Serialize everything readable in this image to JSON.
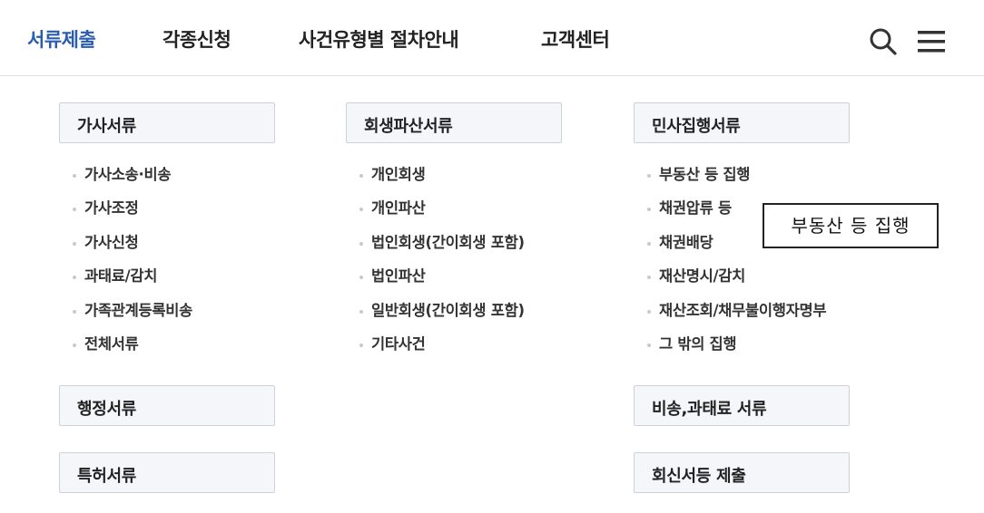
{
  "nav": {
    "items": [
      "서류제출",
      "각종신청",
      "사건유형별 절차안내",
      "고객센터"
    ],
    "active": "서류제출",
    "search_icon": "search-icon",
    "menu_icon": "hamburger-menu-icon",
    "accent_color": "#2a5db0"
  },
  "columns": [
    {
      "categories": [
        {
          "label": "가사서류",
          "items": [
            "가사소송·비송",
            "가사조정",
            "가사신청",
            "과태료/감치",
            "가족관계등록비송",
            "전체서류"
          ]
        },
        {
          "label": "행정서류"
        },
        {
          "label": "특허서류"
        }
      ]
    },
    {
      "categories": [
        {
          "label": "회생파산서류",
          "items": [
            "개인회생",
            "개인파산",
            "법인회생(간이회생 포함)",
            "법인파산",
            "일반회생(간이회생 포함)",
            "기타사건"
          ]
        }
      ]
    },
    {
      "categories": [
        {
          "label": "민사집행서류",
          "items": [
            "부동산 등 집행",
            "채권압류 등",
            "채권배당",
            "재산명시/감치",
            "재산조회/채무불이행자명부",
            "그 밖의 집행"
          ]
        },
        {
          "label": "비송,과태료 서류"
        },
        {
          "label": "회신서등 제출"
        }
      ]
    }
  ],
  "tooltip": "부동산 등 집행"
}
